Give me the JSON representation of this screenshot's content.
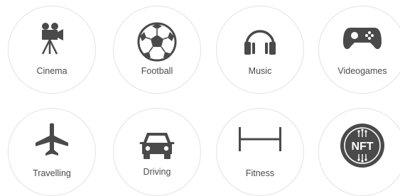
{
  "colors": {
    "icon": "#4a4a4a",
    "circle_border": "#e2e2e2",
    "label": "#4a4a4a",
    "background": "#ffffff"
  },
  "interests": [
    {
      "label": "Cinema",
      "icon": "film-camera-icon"
    },
    {
      "label": "Football",
      "icon": "soccer-ball-icon"
    },
    {
      "label": "Music",
      "icon": "headphones-icon"
    },
    {
      "label": "Videogames",
      "icon": "gamepad-icon"
    },
    {
      "label": "Travelling",
      "icon": "airplane-icon"
    },
    {
      "label": "Driving",
      "icon": "car-icon"
    },
    {
      "label": "Fitness",
      "icon": "dumbbell-bar-icon"
    },
    {
      "label": "",
      "icon": "nft-badge-icon",
      "badge_text": "NFT"
    }
  ]
}
